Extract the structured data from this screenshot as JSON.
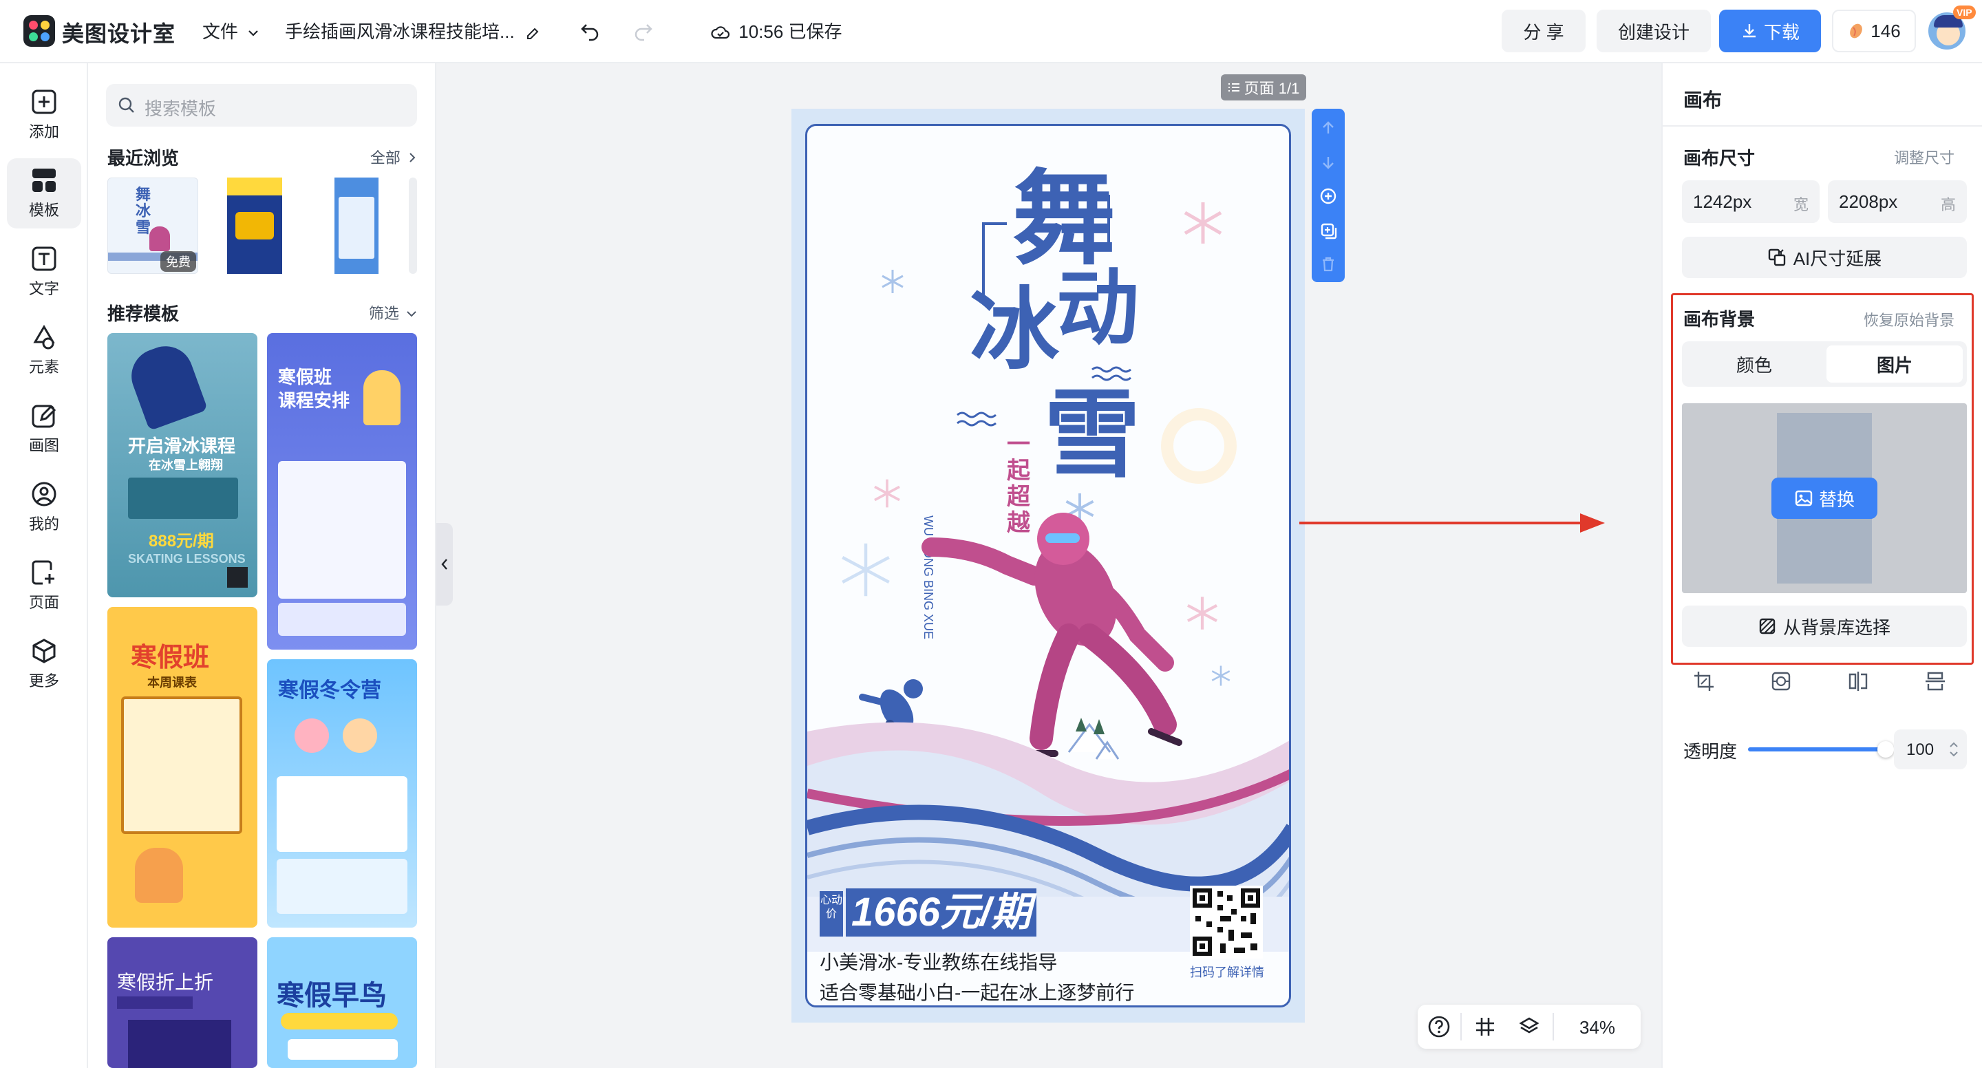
{
  "app": {
    "name": "美图设计室"
  },
  "topbar": {
    "file_menu": "文件",
    "doc_title": "手绘插画风滑冰课程技能培...",
    "save_status": "10:56 已保存",
    "share_label": "分 享",
    "create_label": "创建设计",
    "download_label": "下载",
    "credits": "146",
    "vip_badge": "VIP"
  },
  "rail": {
    "items": [
      {
        "label": "添加",
        "icon": "plus-square-icon"
      },
      {
        "label": "模板",
        "icon": "template-grid-icon"
      },
      {
        "label": "文字",
        "icon": "text-icon"
      },
      {
        "label": "元素",
        "icon": "shapes-icon"
      },
      {
        "label": "画图",
        "icon": "edit-icon"
      },
      {
        "label": "我的",
        "icon": "user-icon"
      },
      {
        "label": "页面",
        "icon": "page-add-icon"
      },
      {
        "label": "更多",
        "icon": "box-icon"
      }
    ]
  },
  "panel": {
    "search_placeholder": "搜索模板",
    "recent_title": "最近浏览",
    "recent_all": "全部",
    "free_badge": "免费",
    "recommend_title": "推荐模板",
    "filter_label": "筛选",
    "cards": [
      {
        "title": "开启滑冰课程",
        "sub": "在冰雪上翱翔",
        "price": "888元/期",
        "en": "SKATING LESSONS"
      },
      {
        "title": "寒假班",
        "sub": "课程安排"
      },
      {
        "title": "寒假班",
        "sub": "本周课表"
      },
      {
        "title": "寒假冬令营"
      },
      {
        "title": "寒假折上折"
      },
      {
        "title": "寒假早鸟"
      }
    ]
  },
  "canvas": {
    "page_tag": "页面 1/1",
    "zoom": "34%"
  },
  "poster": {
    "title_line1": "舞",
    "title_line2a": "冰",
    "title_line2b": "动",
    "title_line3": "雪",
    "vertical_pinyin": "WU DONG BING XUE",
    "slogan": "一起超越",
    "price_prefix": "心动价",
    "price": "1666元/期",
    "line1": "小美滑冰-专业教练在线指导",
    "line2": "适合零基础小白-一起在冰上逐梦前行",
    "qr_caption": "扫码了解详情"
  },
  "rpanel": {
    "title": "画布",
    "size_label": "画布尺寸",
    "resize_link": "调整尺寸",
    "width_value": "1242px",
    "width_unit": "宽",
    "height_value": "2208px",
    "height_unit": "高",
    "ai_expand": "AI尺寸延展",
    "bg_label": "画布背景",
    "restore_bg": "恢复原始背景",
    "tab_color": "颜色",
    "tab_image": "图片",
    "replace_label": "替换",
    "library_label": "从背景库选择",
    "opacity_label": "透明度",
    "opacity_value": "100",
    "opacity_level": 1.0
  },
  "colors": {
    "accent": "#3b82f6",
    "poster_blue": "#3d62b4",
    "poster_pink": "#c04f8e",
    "highlight": "#e0392b"
  }
}
